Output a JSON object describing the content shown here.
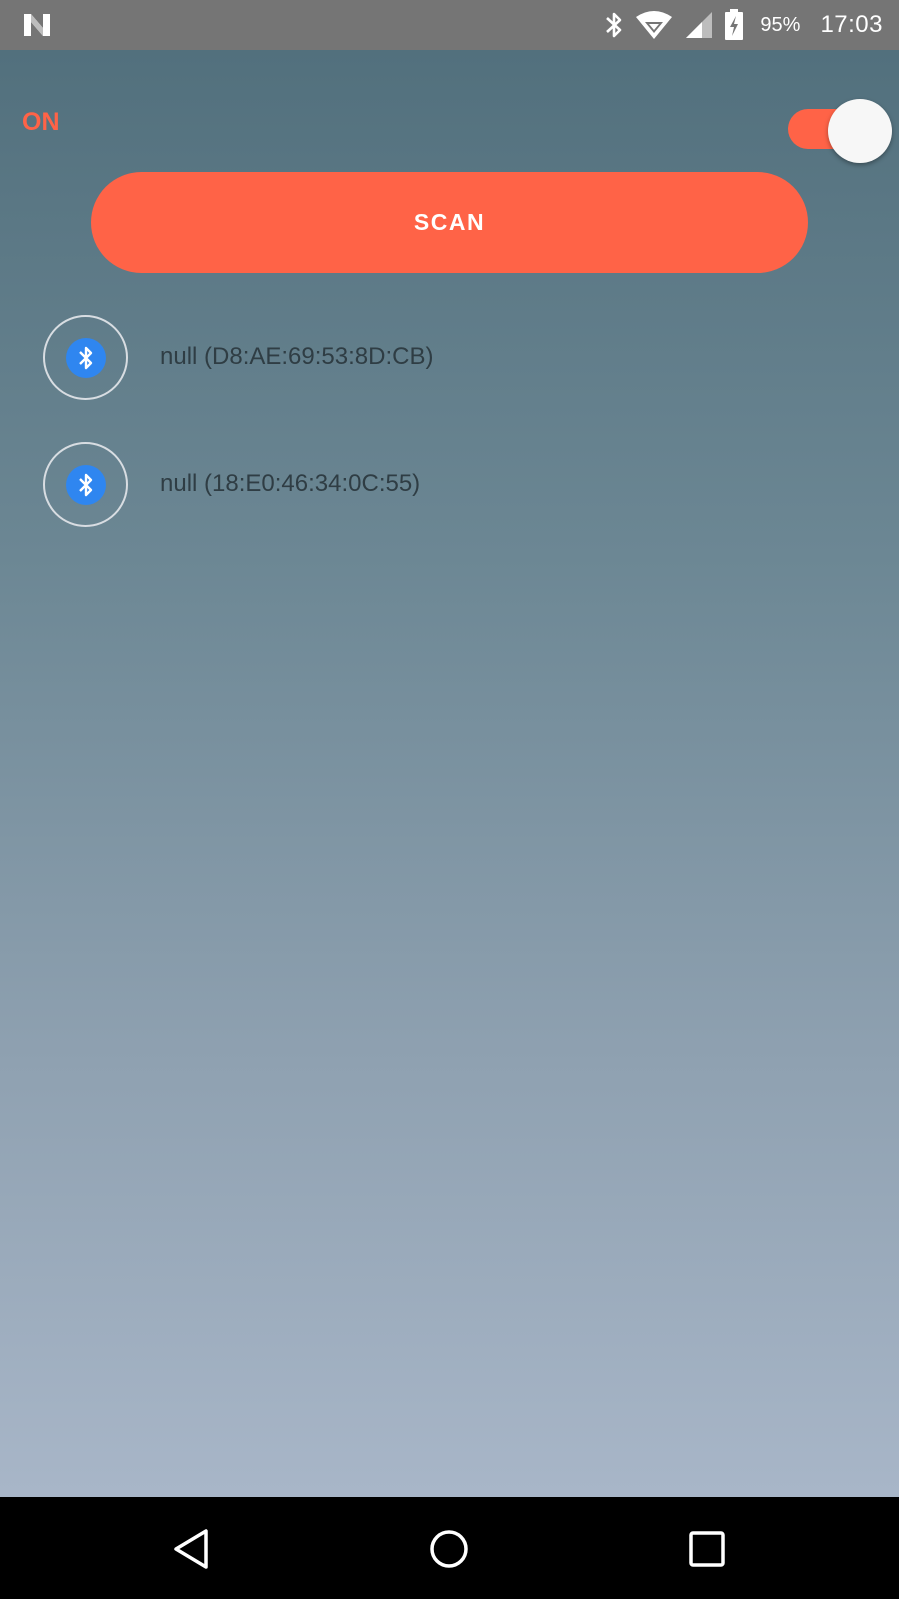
{
  "status_bar": {
    "notification_icon": "n-logo-icon",
    "icons": [
      "bluetooth-icon",
      "wifi-icon",
      "signal-icon",
      "battery-charging-icon"
    ],
    "battery_percent": "95%",
    "time": "17:03"
  },
  "toggle": {
    "label": "ON",
    "state": true
  },
  "scan_button": {
    "label": "SCAN"
  },
  "devices": [
    {
      "icon": "bluetooth-icon",
      "label": "null (D8:AE:69:53:8D:CB)"
    },
    {
      "icon": "bluetooth-icon",
      "label": "null (18:E0:46:34:0C:55)"
    }
  ],
  "nav_bar": {
    "buttons": [
      "back-icon",
      "home-icon",
      "recents-icon"
    ]
  },
  "colors": {
    "accent": "#ff6347",
    "bluetooth_blue": "#2f86f0",
    "status_bar": "#757575",
    "background_top": "#52707d",
    "background_bottom": "#a8b6c8"
  }
}
